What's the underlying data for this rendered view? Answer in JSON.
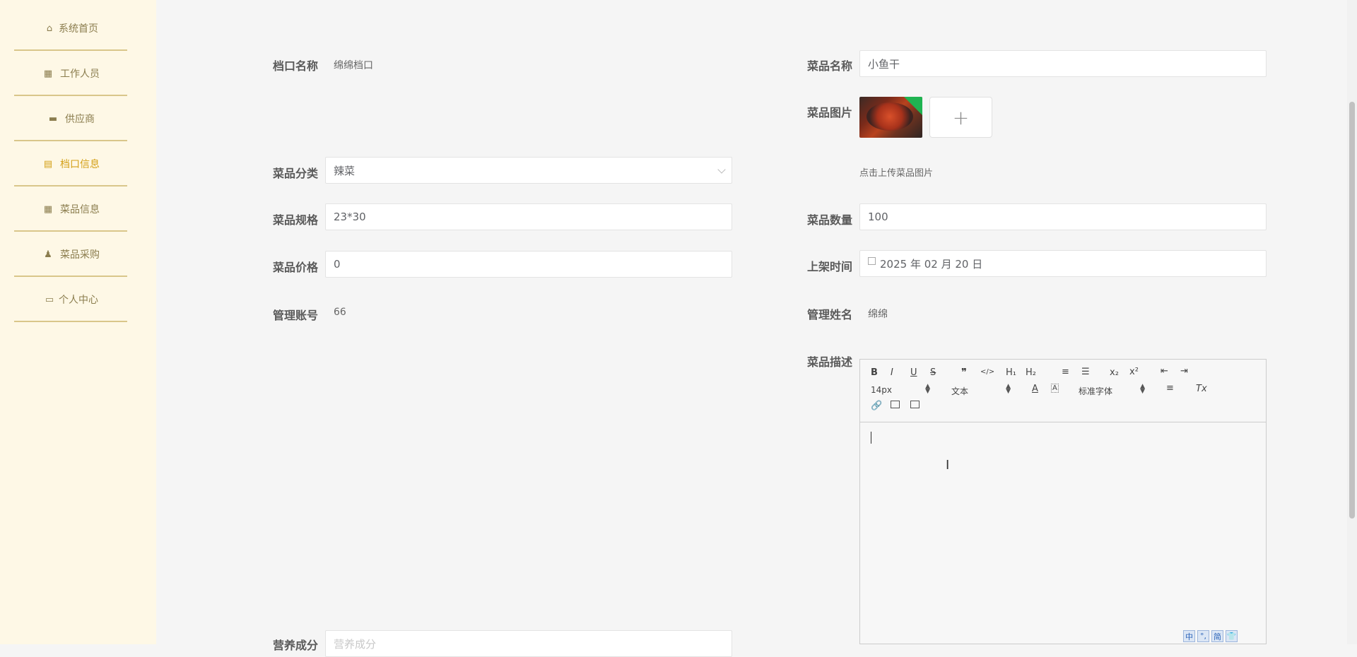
{
  "sidebar": {
    "items": [
      {
        "label": "系统首页",
        "icon": "home-icon"
      },
      {
        "label": "工作人员",
        "icon": "grid-icon"
      },
      {
        "label": "供应商",
        "icon": "briefcase-icon"
      },
      {
        "label": "档口信息",
        "icon": "clipboard-icon",
        "active": true
      },
      {
        "label": "菜品信息",
        "icon": "grid-icon"
      },
      {
        "label": "菜品采购",
        "icon": "user-icon"
      },
      {
        "label": "个人中心",
        "icon": "card-icon"
      }
    ]
  },
  "form": {
    "stall_name": {
      "label": "档口名称",
      "value": "绵绵档口"
    },
    "dish_name": {
      "label": "菜品名称",
      "value": "小鱼干"
    },
    "dish_image": {
      "label": "菜品图片",
      "hint": "点击上传菜品图片",
      "add_symbol": "+"
    },
    "category": {
      "label": "菜品分类",
      "value": "辣菜"
    },
    "spec": {
      "label": "菜品规格",
      "value": "23*30"
    },
    "quantity": {
      "label": "菜品数量",
      "value": "100"
    },
    "price": {
      "label": "菜品价格",
      "value": "0"
    },
    "shelf_time": {
      "label": "上架时间",
      "value": "2025 年 02 月 20 日"
    },
    "manager_account": {
      "label": "管理账号",
      "value": "66"
    },
    "manager_name": {
      "label": "管理姓名",
      "value": "绵绵"
    },
    "description": {
      "label": "菜品描述"
    },
    "nutrition": {
      "label": "营养成分",
      "placeholder": "营养成分"
    }
  },
  "editor": {
    "toolbar": {
      "bold": "B",
      "italic": "I",
      "underline": "U",
      "strike": "S",
      "quote": "❞",
      "code": "</>",
      "h1": "H₁",
      "h2": "H₂",
      "ordered_list": "≡",
      "bullet_list": "☰",
      "sub": "x₂",
      "sup": "x²",
      "outdent": "⇤",
      "indent": "⇥",
      "size": "14px",
      "format": "文本",
      "font": "标准字体",
      "color": "A",
      "background": "A",
      "align": "≡",
      "clean": "Tx"
    }
  },
  "ime_bar": [
    "中",
    "°,",
    "简",
    "👕"
  ]
}
